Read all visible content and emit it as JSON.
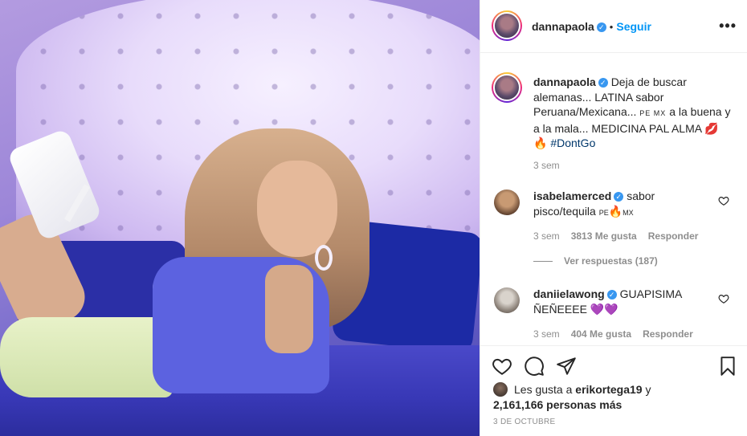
{
  "post": {
    "author": "dannapaola",
    "follow_label": "Seguir",
    "dot": "•",
    "more_label": "•••",
    "caption": {
      "author": "dannapaola",
      "text_1": "Deja de buscar alemanas... LATINA sabor Peruana/Mexicana...",
      "flags": "PE MX",
      "text_2": "a la buena y a la mala... MEDICINA PAL ALMA",
      "emoji_1": "💋",
      "emoji_2": "🔥",
      "hashtag": "#DontGo",
      "time": "3 sem"
    },
    "comments": [
      {
        "author": "isabelamerced",
        "text": "sabor pisco/tequila",
        "flag_1": "PE",
        "emoji": "🔥",
        "flag_2": "MX",
        "time": "3 sem",
        "likes": "3813 Me gusta",
        "reply": "Responder",
        "view_replies": "Ver respuestas (187)"
      },
      {
        "author": "daniielawong",
        "text": "GUAPISIMA ÑEÑEEEE",
        "emoji": "💜💜",
        "time": "3 sem",
        "likes": "404 Me gusta",
        "reply": "Responder"
      }
    ],
    "likes_prefix": "Les gusta a",
    "likes_user": "erikortega19",
    "likes_and": "y",
    "likes_count": "2,161,166 personas más",
    "date": "3 DE OCTUBRE"
  },
  "icons": [
    "heart-icon",
    "comment-icon",
    "share-icon",
    "bookmark-icon",
    "verified-icon"
  ],
  "colors": {
    "accent": "#0095f6",
    "verified": "#3897f0",
    "muted": "#8e8e8e",
    "text": "#262626"
  }
}
